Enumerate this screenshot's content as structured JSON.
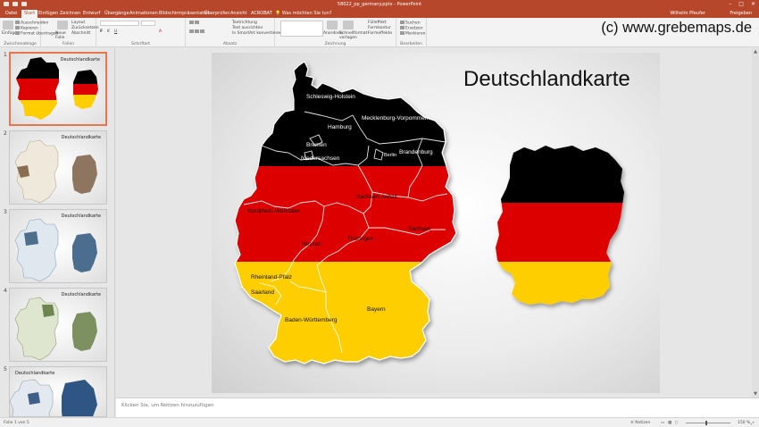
{
  "app": {
    "doc_title": "58022_pp_germany.pptx - PowerPoint",
    "user": "Wilhelm Pfeufer",
    "share": "Freigeben"
  },
  "tabs": [
    "Datei",
    "Start",
    "Einfügen",
    "Zeichnen",
    "Entwurf",
    "Übergänge",
    "Animationen",
    "Bildschirmpräsentation",
    "Überprüfen",
    "Ansicht",
    "ACROBAT"
  ],
  "tellme": "Was möchten Sie tun?",
  "ribbon": {
    "clipboard": {
      "paste": "Einfügen",
      "cut": "Ausschneiden",
      "copy": "Kopieren",
      "format": "Format übertragen",
      "label": "Zwischenablage"
    },
    "slides": {
      "new": "Neue Folie",
      "layout": "Layout",
      "reset": "Zurücksetzen",
      "section": "Abschnitt",
      "label": "Folien"
    },
    "font": {
      "label": "Schriftart"
    },
    "paragraph": {
      "direction": "Textrichtung",
      "align": "Text ausrichten",
      "smartart": "In SmartArt konvertieren",
      "label": "Absatz"
    },
    "drawing": {
      "arrange": "Anordnen",
      "quickstyles": "Schnellformat-vorlagen",
      "fill": "Fülleffekt",
      "outline": "Formkontur",
      "effects": "Formeffekte",
      "label": "Zeichnung"
    },
    "editing": {
      "find": "Suchen",
      "replace": "Ersetzen",
      "select": "Markieren",
      "label": "Bearbeiten"
    }
  },
  "watermark": "(c) www.grebemaps.de",
  "thumbnails": [
    {
      "num": "1",
      "title": "Deutschlandkarte"
    },
    {
      "num": "2",
      "title": "Deutschlandkarte"
    },
    {
      "num": "3",
      "title": "Deutschlandkarte"
    },
    {
      "num": "4",
      "title": "Deutschlandkarte"
    },
    {
      "num": "5",
      "title": "Deutschlandkarte"
    }
  ],
  "slide": {
    "title": "Deutschlandkarte",
    "flag_colors": {
      "black": "#000000",
      "red": "#dd0000",
      "gold": "#ffce00"
    },
    "states": {
      "sh": "Schleswig-Holstein",
      "mv": "Mecklenburg-Vorpommern",
      "hh": "Hamburg",
      "hb": "Bremen",
      "ni": "Niedersachsen",
      "bb": "Brandenburg",
      "be": "Berlin",
      "st": "Sachsen-Anhalt",
      "nw": "Nordrhein-Westfalen",
      "sn": "Sachsen",
      "th": "Thüringen",
      "he": "Hessen",
      "rp": "Rheinland-Pfalz",
      "sl": "Saarland",
      "by": "Bayern",
      "bw": "Baden-Württemberg"
    }
  },
  "notes": "Klicken Sie, um Notizen hinzuzufügen",
  "status": {
    "slide": "Folie 1 von 5",
    "notes": "Notizen",
    "zoom": "150 %"
  }
}
